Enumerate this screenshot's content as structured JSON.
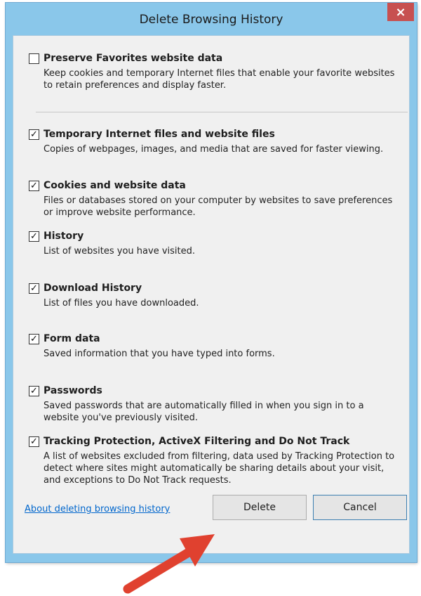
{
  "dialog": {
    "title": "Delete Browsing History",
    "close_label": "×"
  },
  "options": [
    {
      "label": "Preserve Favorites website data",
      "description": "Keep cookies and temporary Internet files that enable your favorite websites to retain preferences and display faster.",
      "checked": false
    },
    {
      "label": "Temporary Internet files and website files",
      "description": "Copies of webpages, images, and media that are saved for faster viewing.",
      "checked": true
    },
    {
      "label": "Cookies and website data",
      "description": "Files or databases stored on your computer by websites to save preferences or improve website performance.",
      "checked": true
    },
    {
      "label": "History",
      "description": "List of websites you have visited.",
      "checked": true
    },
    {
      "label": "Download History",
      "description": "List of files you have downloaded.",
      "checked": true
    },
    {
      "label": "Form data",
      "description": "Saved information that you have typed into forms.",
      "checked": true
    },
    {
      "label": "Passwords",
      "description": "Saved passwords that are automatically filled in when you sign in to a website you've previously visited.",
      "checked": true
    },
    {
      "label": "Tracking Protection, ActiveX Filtering and Do Not Track",
      "description": "A list of websites excluded from filtering, data used by Tracking Protection to detect where sites might automatically be sharing details about your visit, and exceptions to Do Not Track requests.",
      "checked": true
    }
  ],
  "footer": {
    "help_link": "About deleting browsing history",
    "delete_label": "Delete",
    "cancel_label": "Cancel"
  },
  "colors": {
    "frame": "#8ac7ea",
    "close_button": "#c75050",
    "link": "#0066cc",
    "annotation_arrow": "#e0412f"
  }
}
